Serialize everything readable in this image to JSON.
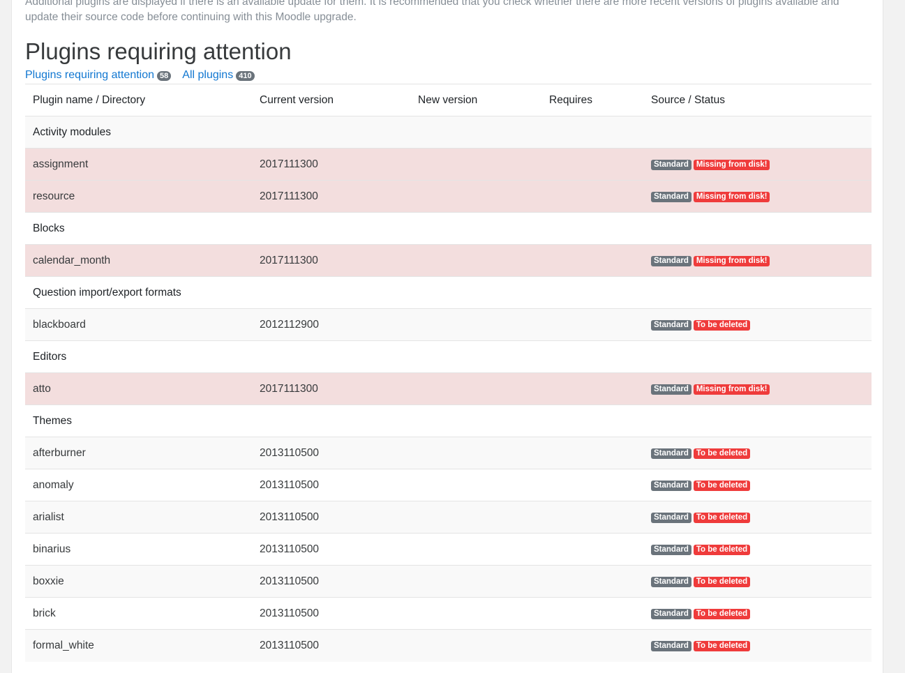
{
  "intro_text": "Additional plugins are displayed if there is an available update for them. It is recommended that you check whether there are more recent versions of plugins available and update their source code before continuing with this Moodle upgrade.",
  "page_title": "Plugins requiring attention",
  "filters": {
    "attention_label": "Plugins requiring attention",
    "attention_count": "58",
    "all_label": "All plugins",
    "all_count": "410"
  },
  "table": {
    "headers": {
      "name": "Plugin name / Directory",
      "current_version": "Current version",
      "new_version": "New version",
      "requires": "Requires",
      "source_status": "Source / Status"
    },
    "rows": [
      {
        "type": "group",
        "label": "Activity modules"
      },
      {
        "type": "plugin",
        "name": "assignment",
        "version": "2017111300",
        "source": "Standard",
        "status": "Missing from disk!",
        "missing": true
      },
      {
        "type": "plugin",
        "name": "resource",
        "version": "2017111300",
        "source": "Standard",
        "status": "Missing from disk!",
        "missing": true
      },
      {
        "type": "group",
        "label": "Blocks"
      },
      {
        "type": "plugin",
        "name": "calendar_month",
        "version": "2017111300",
        "source": "Standard",
        "status": "Missing from disk!",
        "missing": true
      },
      {
        "type": "group",
        "label": "Question import/export formats"
      },
      {
        "type": "plugin",
        "name": "blackboard",
        "version": "2012112900",
        "source": "Standard",
        "status": "To be deleted",
        "missing": false
      },
      {
        "type": "group",
        "label": "Editors"
      },
      {
        "type": "plugin",
        "name": "atto",
        "version": "2017111300",
        "source": "Standard",
        "status": "Missing from disk!",
        "missing": true
      },
      {
        "type": "group",
        "label": "Themes"
      },
      {
        "type": "plugin",
        "name": "afterburner",
        "version": "2013110500",
        "source": "Standard",
        "status": "To be deleted",
        "missing": false
      },
      {
        "type": "plugin",
        "name": "anomaly",
        "version": "2013110500",
        "source": "Standard",
        "status": "To be deleted",
        "missing": false
      },
      {
        "type": "plugin",
        "name": "arialist",
        "version": "2013110500",
        "source": "Standard",
        "status": "To be deleted",
        "missing": false
      },
      {
        "type": "plugin",
        "name": "binarius",
        "version": "2013110500",
        "source": "Standard",
        "status": "To be deleted",
        "missing": false
      },
      {
        "type": "plugin",
        "name": "boxxie",
        "version": "2013110500",
        "source": "Standard",
        "status": "To be deleted",
        "missing": false
      },
      {
        "type": "plugin",
        "name": "brick",
        "version": "2013110500",
        "source": "Standard",
        "status": "To be deleted",
        "missing": false
      },
      {
        "type": "plugin",
        "name": "formal_white",
        "version": "2013110500",
        "source": "Standard",
        "status": "To be deleted",
        "missing": false
      }
    ]
  },
  "colors": {
    "link": "#1177d1",
    "badge_standard": "#6a737b",
    "badge_status": "#ef3b3b",
    "row_missing": "#f3dede",
    "row_stripe": "#f9f9f9"
  }
}
